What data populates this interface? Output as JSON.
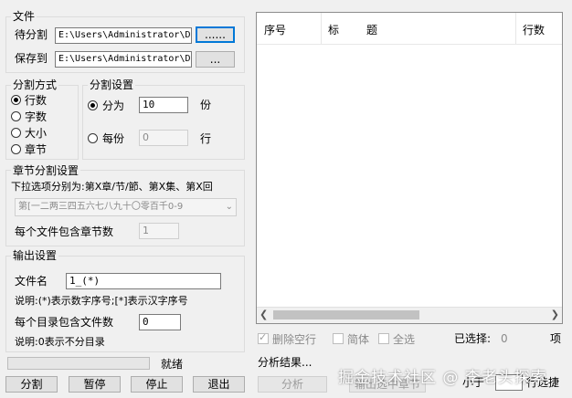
{
  "file": {
    "group_title": "文件",
    "split_label": "待分割",
    "split_path": "E:\\Users\\Administrator\\D",
    "browse1_label": "......",
    "save_label": "保存到",
    "save_path": "E:\\Users\\Administrator\\D",
    "browse2_label": "..."
  },
  "split_method": {
    "group_title": "分割方式",
    "options": [
      "行数",
      "字数",
      "大小",
      "章节"
    ],
    "selected": "行数"
  },
  "split_settings": {
    "group_title": "分割设置",
    "divide_label": "分为",
    "divide_value": "10",
    "divide_unit": "份",
    "each_label": "每份",
    "each_value": "0",
    "each_unit": "行"
  },
  "chapter": {
    "group_title": "章节分割设置",
    "desc": "下拉选项分别为:第X章/节/節、第X集、第X回",
    "dropdown_value": "第[一二两三四五六七八九十〇零百千0-9",
    "per_file_label": "每个文件包含章节数",
    "per_file_value": "1"
  },
  "output": {
    "group_title": "输出设置",
    "filename_label": "文件名",
    "filename_value": "1_(*)",
    "note1": "说明:(*)表示数字序号;[*]表示汉字序号",
    "per_dir_label": "每个目录包含文件数",
    "per_dir_value": "0",
    "note2": "说明:0表示不分目录"
  },
  "status": {
    "text": "就绪",
    "progress": 0
  },
  "actions": {
    "split": "分割",
    "pause": "暂停",
    "stop": "停止",
    "exit": "退出"
  },
  "table": {
    "columns": [
      "序号",
      "标",
      "题",
      "行数"
    ],
    "rows": []
  },
  "options": {
    "remove_blank": "删除空行",
    "simplified": "简体",
    "select_all": "全选",
    "selected_label": "已选择:",
    "selected_count": "0",
    "selected_unit": "项",
    "less_than_label": "小于",
    "less_than_suffix": "行选捷"
  },
  "analysis": {
    "result_label": "分析结果...",
    "analyze_button": "分析",
    "export_button": "输出选中章节"
  },
  "watermark": "掘金技术社区 @ 李老头探索"
}
